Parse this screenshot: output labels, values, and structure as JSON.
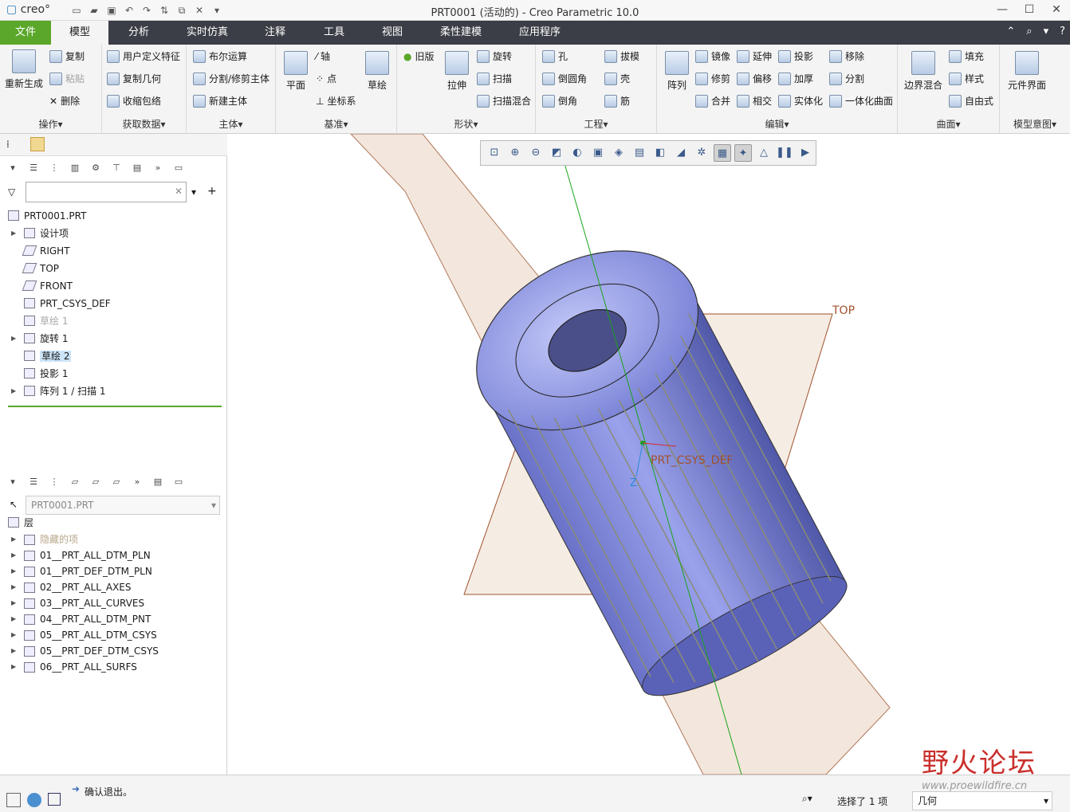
{
  "app": {
    "logo": "creo",
    "title": "PRT0001 (活动的) - Creo Parametric 10.0"
  },
  "window_buttons": [
    "—",
    "☐",
    "✕"
  ],
  "menu": {
    "file": "文件",
    "tabs": [
      "模型",
      "分析",
      "实时仿真",
      "注释",
      "工具",
      "视图",
      "柔性建模",
      "应用程序"
    ],
    "right_icons": [
      "⌃",
      "⌕",
      "?"
    ]
  },
  "ribbon": {
    "operations": {
      "label": "操作▾",
      "regen": "重新生成",
      "copy": "复制",
      "paste": "粘贴",
      "delete": "删除"
    },
    "get_data": {
      "label": "获取数据▾",
      "udf": "用户定义特征",
      "copy_geom": "复制几何",
      "shrinkwrap": "收缩包络"
    },
    "body": {
      "label": "主体▾",
      "boolean": "布尔运算",
      "split": "分割/修剪主体",
      "new_body": "新建主体"
    },
    "datum": {
      "label": "基准▾",
      "plane": "平面",
      "axis": "轴",
      "point": "点",
      "csys": "坐标系",
      "sketch": "草绘"
    },
    "shapes": {
      "label": "形状▾",
      "legacy": "旧版",
      "extrude": "拉伸",
      "revolve": "旋转",
      "sweep": "扫描",
      "swept_blend": "扫描混合"
    },
    "engineering": {
      "label": "工程▾",
      "hole": "孔",
      "draft": "拔模",
      "round": "倒圆角",
      "shell": "壳",
      "chamfer": "倒角",
      "rib": "筋"
    },
    "editing": {
      "label": "编辑▾",
      "pattern": "阵列",
      "mirror": "镜像",
      "extend": "延伸",
      "project": "投影",
      "move": "移除",
      "trim": "修剪",
      "offset": "偏移",
      "thicken": "加厚",
      "split": "分割",
      "merge": "合并",
      "intersect": "相交",
      "solidify": "实体化",
      "unify": "一体化曲面"
    },
    "surfaces": {
      "label": "曲面▾",
      "boundary": "边界混合",
      "fill": "填充",
      "style": "样式",
      "freestyle": "自由式"
    },
    "model_intent": {
      "label": "模型意图▾",
      "component_interface": "元件界面"
    }
  },
  "model_tree": {
    "filter_placeholder": "",
    "root": "PRT0001.PRT",
    "items": [
      {
        "label": "设计项",
        "expandable": true,
        "state": "normal"
      },
      {
        "label": "RIGHT",
        "expandable": false,
        "state": "normal"
      },
      {
        "label": "TOP",
        "expandable": false,
        "state": "normal"
      },
      {
        "label": "FRONT",
        "expandable": false,
        "state": "normal"
      },
      {
        "label": "PRT_CSYS_DEF",
        "expandable": false,
        "state": "normal"
      },
      {
        "label": "草绘 1",
        "expandable": false,
        "state": "hidden"
      },
      {
        "label": "旋转 1",
        "expandable": true,
        "state": "normal"
      },
      {
        "label": "草绘 2",
        "expandable": false,
        "state": "selected"
      },
      {
        "label": "投影 1",
        "expandable": false,
        "state": "normal"
      },
      {
        "label": "阵列 1 / 扫描 1",
        "expandable": true,
        "state": "normal"
      }
    ]
  },
  "layer_tree": {
    "selector": "PRT0001.PRT",
    "header": "层",
    "items": [
      "隐藏的项",
      "01__PRT_ALL_DTM_PLN",
      "01__PRT_DEF_DTM_PLN",
      "02__PRT_ALL_AXES",
      "03__PRT_ALL_CURVES",
      "04__PRT_ALL_DTM_PNT",
      "05__PRT_ALL_DTM_CSYS",
      "05__PRT_DEF_DTM_CSYS",
      "06__PRT_ALL_SURFS"
    ]
  },
  "viewport": {
    "datum_top": "TOP",
    "csys_label": "PRT_CSYS_DEF",
    "axis_z": "Z"
  },
  "status": {
    "message": "确认退出。",
    "selection": "选择了 1 项",
    "filter": "几何"
  },
  "watermark": {
    "text": "野火论坛",
    "url": "www.proewildfire.cn"
  },
  "colors": {
    "file_tab": "#5aa72a",
    "menubar": "#3b3e46",
    "model": "#8c94e0",
    "datum_plane": "#a0522d"
  }
}
